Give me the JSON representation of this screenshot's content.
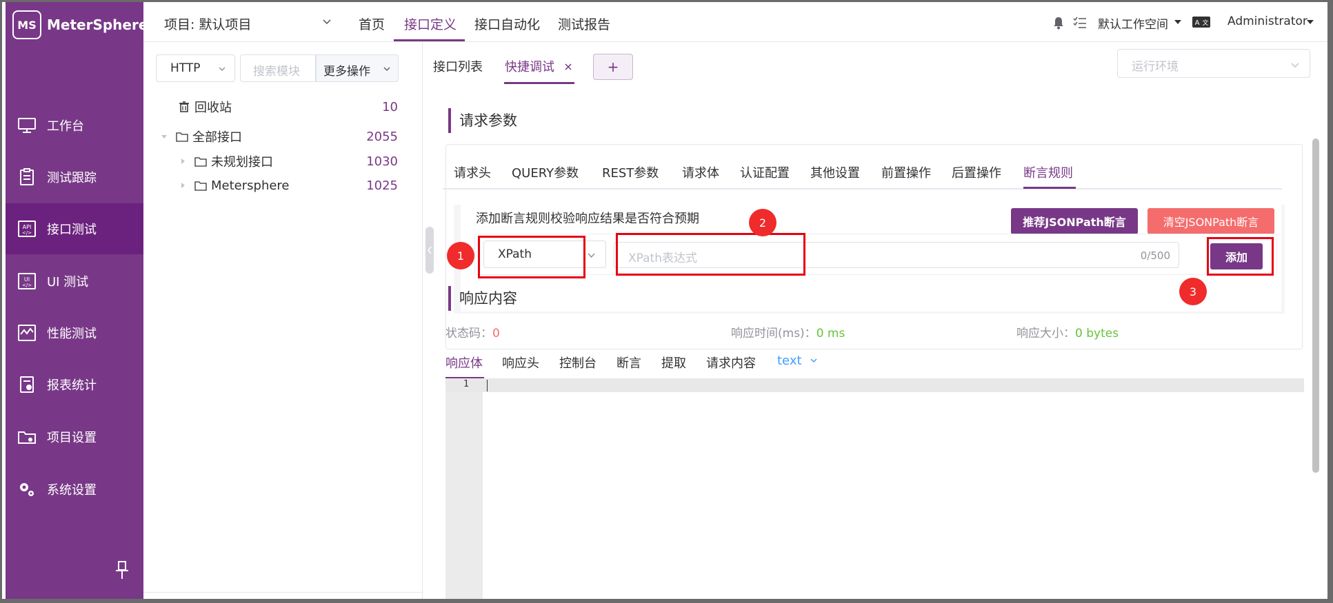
{
  "app": {
    "logo_mark": "MS",
    "name": "MeterSphere"
  },
  "sidebar": {
    "items": [
      {
        "label": "工作台",
        "icon": "monitor-icon",
        "active": false
      },
      {
        "label": "测试跟踪",
        "icon": "clipboard-icon",
        "active": false
      },
      {
        "label": "接口测试",
        "icon": "api-icon",
        "active": true
      },
      {
        "label": "UI 测试",
        "icon": "ui-icon",
        "active": false
      },
      {
        "label": "性能测试",
        "icon": "performance-icon",
        "active": false
      },
      {
        "label": "报表统计",
        "icon": "report-icon",
        "active": false
      },
      {
        "label": "项目设置",
        "icon": "folder-settings-icon",
        "active": false
      },
      {
        "label": "系统设置",
        "icon": "gears-icon",
        "active": false
      }
    ]
  },
  "header": {
    "project": "项目: 默认项目",
    "menu": [
      "首页",
      "接口定义",
      "接口自动化",
      "测试报告"
    ],
    "active_menu": "接口定义",
    "workspace": "默认工作空间",
    "user": "Administrator"
  },
  "tree": {
    "protocol": "HTTP",
    "search_placeholder": "搜索模块",
    "more_ops": "更多操作",
    "nodes": [
      {
        "label": "回收站",
        "count": "10",
        "icon": "trash-icon",
        "level": 0
      },
      {
        "label": "全部接口",
        "count": "2055",
        "icon": "folder-icon",
        "level": 0
      },
      {
        "label": "未规划接口",
        "count": "1030",
        "icon": "folder-icon",
        "level": 1
      },
      {
        "label": "Metersphere",
        "count": "1025",
        "icon": "folder-icon",
        "level": 1
      }
    ]
  },
  "main": {
    "tabs": [
      {
        "label": "接口列表"
      },
      {
        "label": "快捷调试"
      }
    ],
    "add_tab": "+",
    "env_placeholder": "运行环境",
    "request_title": "请求参数",
    "request_tabs": [
      "请求头",
      "QUERY参数",
      "REST参数",
      "请求体",
      "认证配置",
      "其他设置",
      "前置操作",
      "后置操作",
      "断言规则"
    ],
    "assertion": {
      "description": "添加断言规则校验响应结果是否符合预期",
      "recommend_btn": "推荐JSONPath断言",
      "clear_btn": "清空JSONPath断言",
      "type": "XPath",
      "expression_placeholder": "XPath表达式",
      "char_count": "0/500",
      "add_btn": "添加"
    },
    "badges": [
      "1",
      "2",
      "3"
    ],
    "response_title": "响应内容",
    "status_label": "状态码：",
    "status_value": "0",
    "time_label": "响应时间(ms)：",
    "time_value": "0 ms",
    "size_label": "响应大小：",
    "size_value": "0 bytes",
    "response_tabs": [
      "响应体",
      "响应头",
      "控制台",
      "断言",
      "提取",
      "请求内容"
    ],
    "format": "text",
    "editor_line": "1"
  },
  "colors": {
    "brand": "#783887",
    "brand_dark": "#6b227e",
    "danger": "#f56c6c",
    "success": "#67c23a",
    "link": "#409eff",
    "annotation": "#e60012"
  }
}
